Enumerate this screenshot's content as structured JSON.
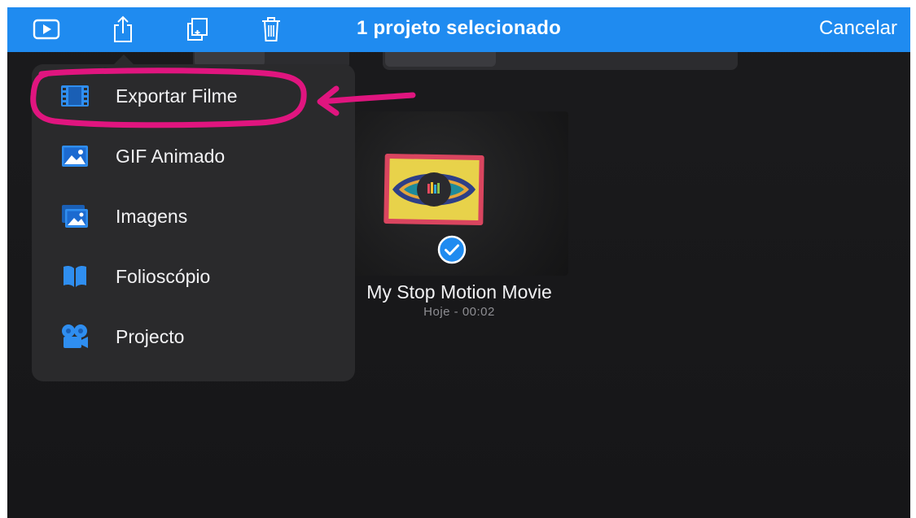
{
  "navbar": {
    "title": "1 projeto selecionado",
    "cancel_label": "Cancelar",
    "icons": [
      "play-icon",
      "share-icon",
      "duplicate-icon",
      "trash-icon"
    ]
  },
  "menu": {
    "items": [
      {
        "label": "Exportar Filme",
        "icon": "film-icon",
        "highlighted": true
      },
      {
        "label": "GIF Animado",
        "icon": "photo-icon"
      },
      {
        "label": "Imagens",
        "icon": "photos-icon"
      },
      {
        "label": "Folioscópio",
        "icon": "book-icon"
      },
      {
        "label": "Projecto",
        "icon": "camera-icon"
      }
    ]
  },
  "project": {
    "title": "My Stop Motion Movie",
    "subtitle": "Hoje - 00:02",
    "selected": true
  },
  "colors": {
    "accent": "#1f8bf0",
    "annotation": "#e0157f",
    "menu_bg": "#2a2a2c",
    "background": "#1b1b1d"
  }
}
